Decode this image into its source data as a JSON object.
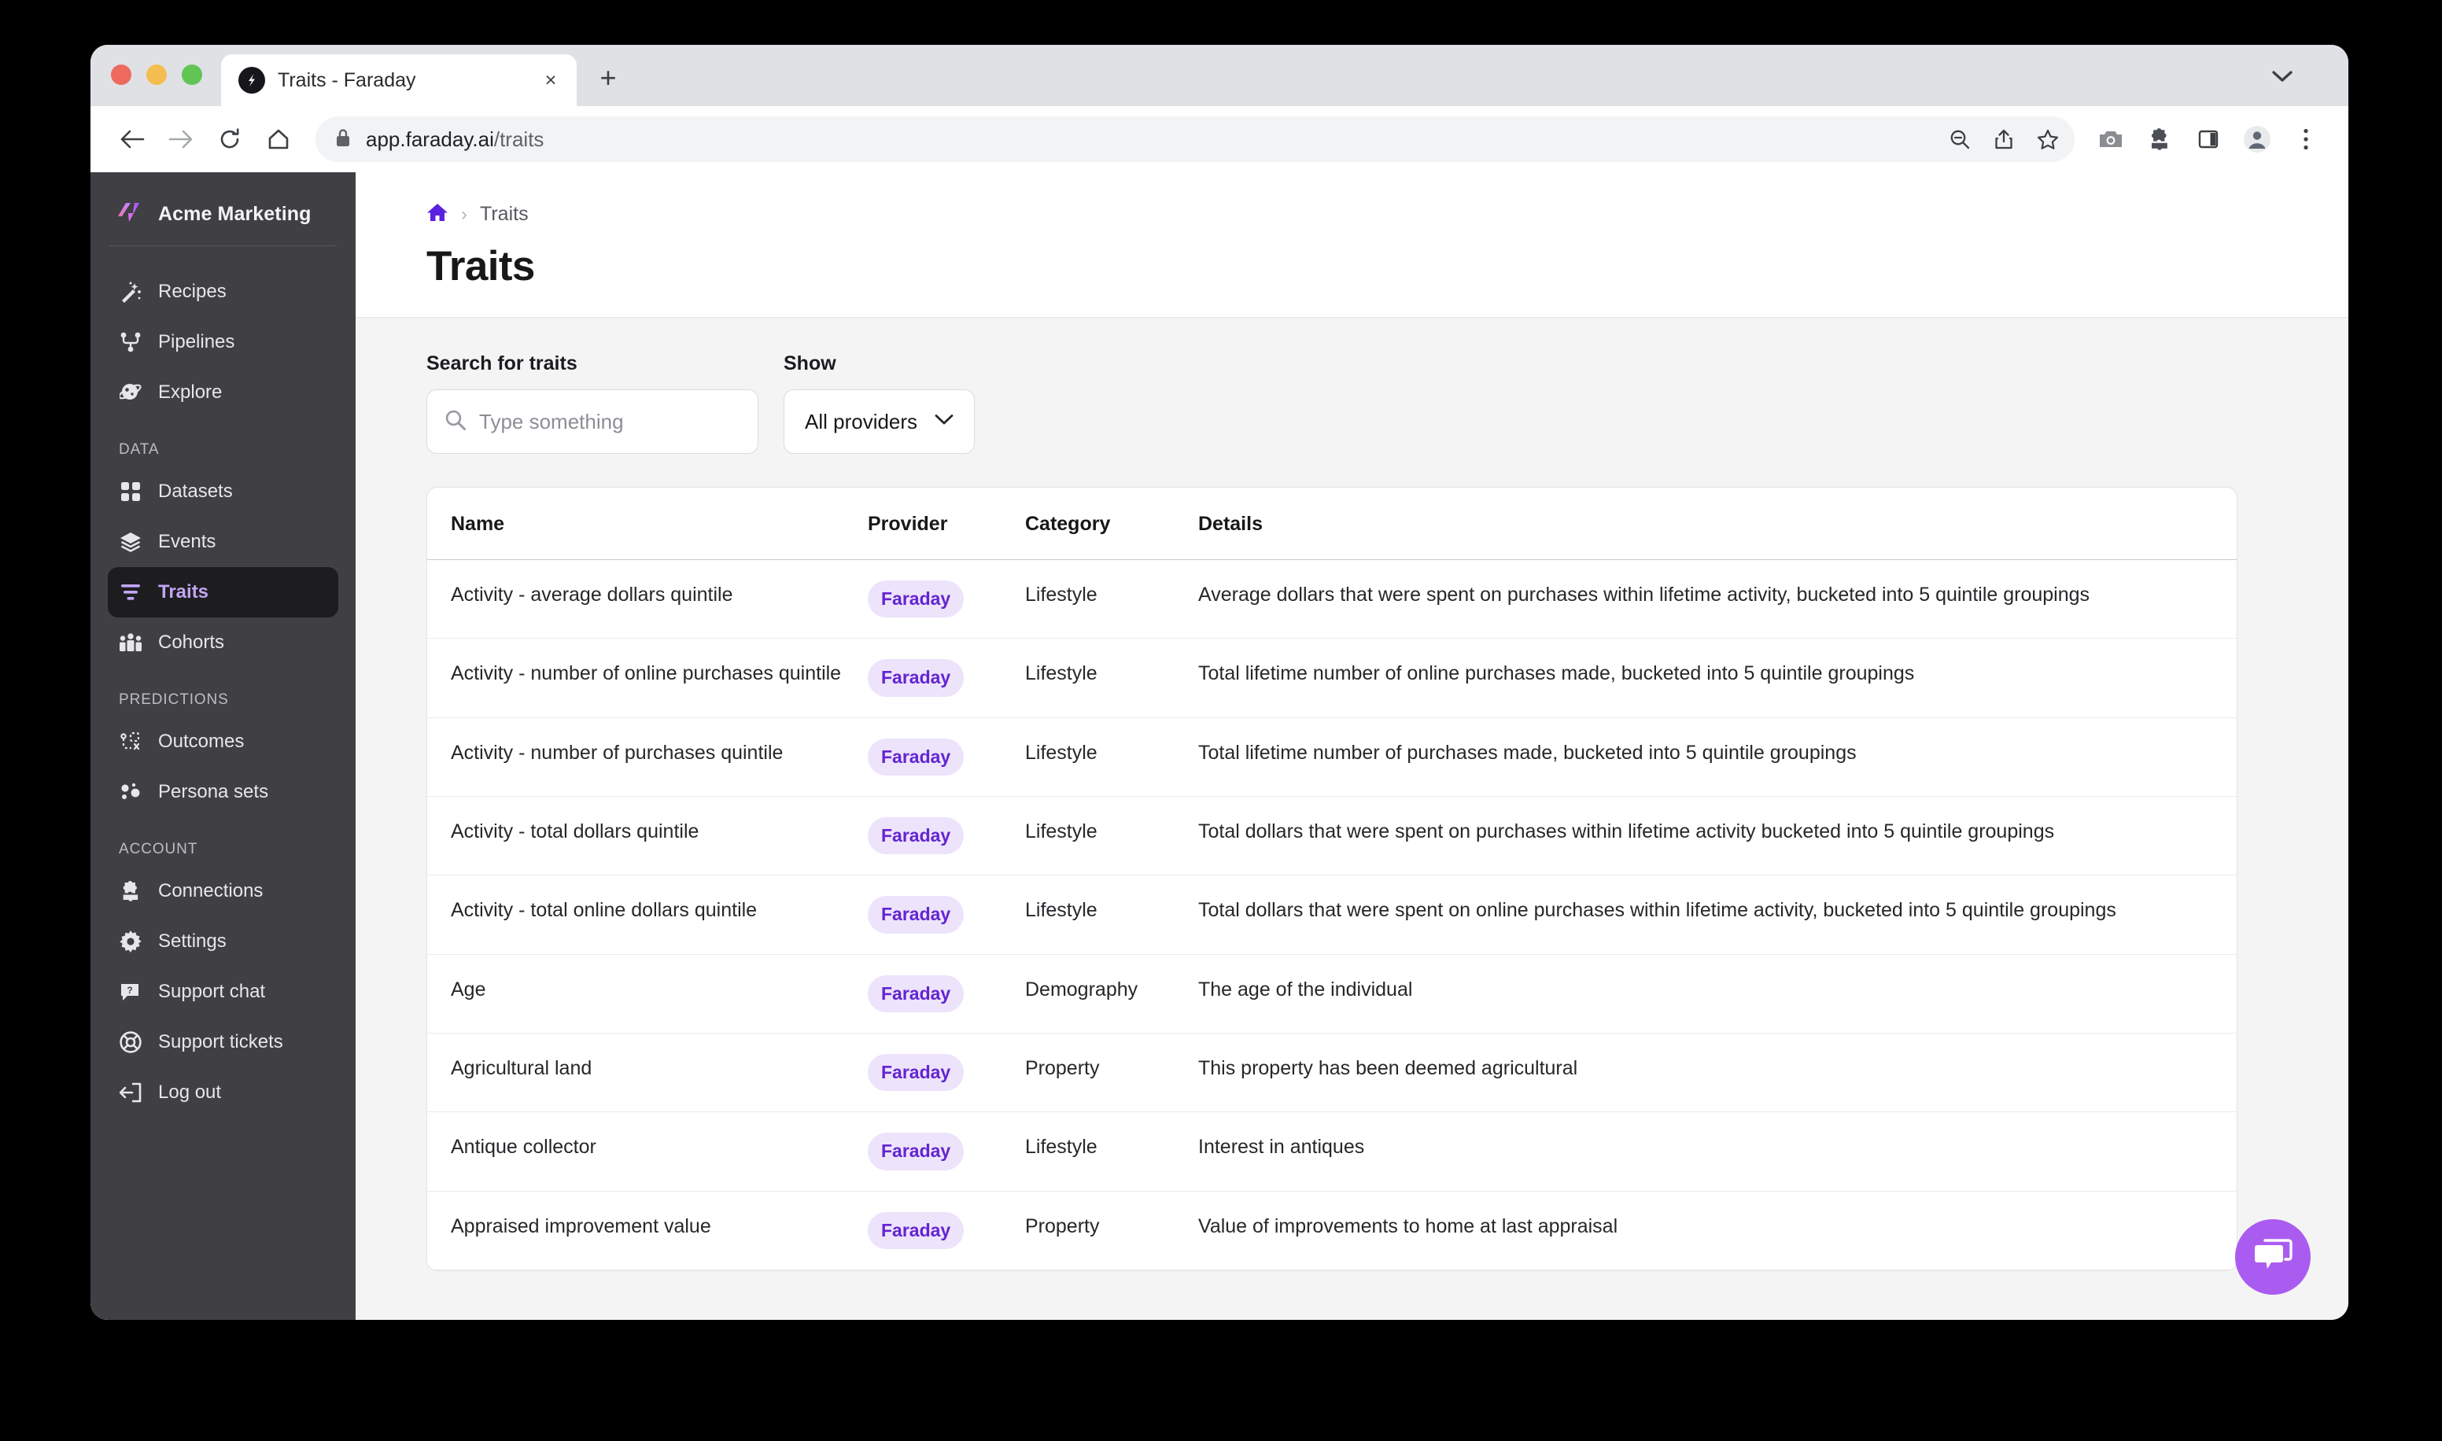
{
  "browser": {
    "tab_title": "Traits - Faraday",
    "url_domain": "app.faraday.ai",
    "url_path": "/traits",
    "close_glyph": "×",
    "new_tab_glyph": "+",
    "icons": {
      "back": "back-arrow-icon",
      "forward": "forward-arrow-icon",
      "reload": "reload-icon",
      "home": "home-icon",
      "lock": "lock-icon",
      "zoom_out": "zoom-out-icon",
      "share": "share-icon",
      "bookmark": "star-icon",
      "screenshot": "camera-icon",
      "extensions": "puzzle-icon",
      "side_panel": "side-panel-icon",
      "profile": "profile-avatar-icon",
      "menu": "three-dot-menu-icon",
      "tab_list": "chevron-down-icon"
    }
  },
  "sidebar": {
    "brand": "Acme Marketing",
    "groups": [
      {
        "section": null,
        "items": [
          {
            "label": "Recipes",
            "icon": "magic-wand-icon",
            "active": false
          },
          {
            "label": "Pipelines",
            "icon": "pipeline-icon",
            "active": false
          },
          {
            "label": "Explore",
            "icon": "planet-icon",
            "active": false
          }
        ]
      },
      {
        "section": "DATA",
        "items": [
          {
            "label": "Datasets",
            "icon": "grid-icon",
            "active": false
          },
          {
            "label": "Events",
            "icon": "layers-icon",
            "active": false
          },
          {
            "label": "Traits",
            "icon": "filter-icon",
            "active": true
          },
          {
            "label": "Cohorts",
            "icon": "people-icon",
            "active": false
          }
        ]
      },
      {
        "section": "PREDICTIONS",
        "items": [
          {
            "label": "Persona sets",
            "icon": "scatter-dots-icon",
            "active": false
          },
          {
            "label": "Outcomes",
            "icon": "outcome-icon",
            "active": false
          }
        ]
      },
      {
        "section": "ACCOUNT",
        "items": [
          {
            "label": "Connections",
            "icon": "puzzle-icon",
            "active": false
          },
          {
            "label": "Settings",
            "icon": "gear-icon",
            "active": false
          },
          {
            "label": "Support chat",
            "icon": "chat-help-icon",
            "active": false
          },
          {
            "label": "Support tickets",
            "icon": "lifebuoy-icon",
            "active": false
          },
          {
            "label": "Log out",
            "icon": "logout-icon",
            "active": false
          }
        ]
      }
    ]
  },
  "header": {
    "breadcrumb_home_icon": "home-icon",
    "breadcrumb_separator": "›",
    "breadcrumb_current": "Traits",
    "title": "Traits"
  },
  "filters": {
    "search_label": "Search for traits",
    "search_placeholder": "Type something",
    "search_value": "",
    "search_icon": "search-icon",
    "show_label": "Show",
    "provider_value": "All providers",
    "provider_chevron": "chevron-down-icon"
  },
  "table": {
    "columns": [
      "Name",
      "Provider",
      "Category",
      "Details"
    ],
    "rows": [
      {
        "name": "Activity - average dollars quintile",
        "provider": "Faraday",
        "category": "Lifestyle",
        "details": "Average dollars that were spent on purchases within lifetime activity, bucketed into 5 quintile groupings"
      },
      {
        "name": "Activity - number of online purchases quintile",
        "provider": "Faraday",
        "category": "Lifestyle",
        "details": "Total lifetime number of online purchases made, bucketed into 5 quintile groupings"
      },
      {
        "name": "Activity - number of purchases quintile",
        "provider": "Faraday",
        "category": "Lifestyle",
        "details": "Total lifetime number of purchases made, bucketed into 5 quintile groupings"
      },
      {
        "name": "Activity - total dollars quintile",
        "provider": "Faraday",
        "category": "Lifestyle",
        "details": "Total dollars that were spent on purchases within lifetime activity bucketed into 5 quintile groupings"
      },
      {
        "name": "Activity - total online dollars quintile",
        "provider": "Faraday",
        "category": "Lifestyle",
        "details": "Total dollars that were spent on online purchases within lifetime activity, bucketed into 5 quintile groupings"
      },
      {
        "name": "Age",
        "provider": "Faraday",
        "category": "Demography",
        "details": "The age of the individual"
      },
      {
        "name": "Agricultural land",
        "provider": "Faraday",
        "category": "Property",
        "details": "This property has been deemed agricultural"
      },
      {
        "name": "Antique collector",
        "provider": "Faraday",
        "category": "Lifestyle",
        "details": "Interest in antiques"
      },
      {
        "name": "Appraised improvement value",
        "provider": "Faraday",
        "category": "Property",
        "details": "Value of improvements to home at last appraisal"
      }
    ]
  },
  "chat": {
    "icon": "chat-bubble-icon"
  },
  "colors": {
    "accent_purple": "#6325d2",
    "badge_bg": "#ede3fb",
    "sidebar_bg": "#3f3f44",
    "active_nav_bg": "#1d1d20",
    "active_nav_text": "#c2a5f2",
    "page_bg": "#f4f4f5",
    "chat_bg": "#ab5cf0"
  }
}
